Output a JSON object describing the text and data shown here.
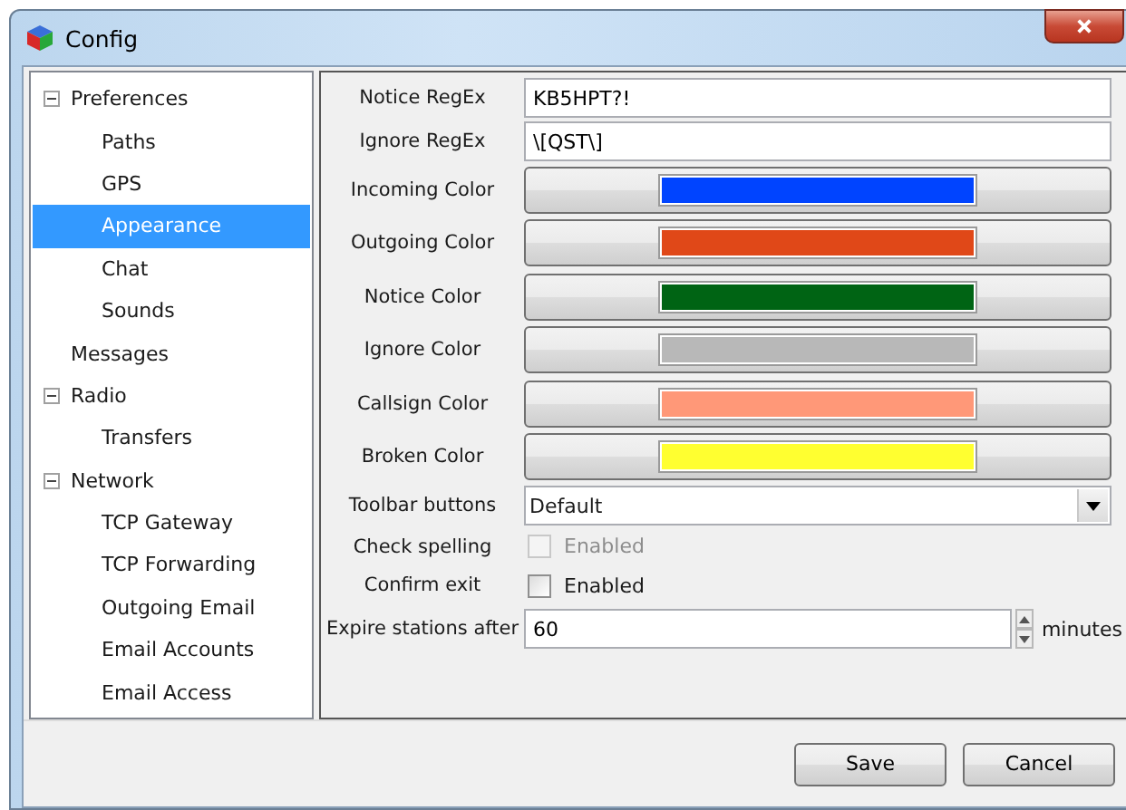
{
  "window": {
    "title": "Config"
  },
  "tree": [
    {
      "label": "Preferences",
      "expanded": true,
      "selected": false,
      "children": [
        {
          "label": "Paths",
          "selected": false
        },
        {
          "label": "GPS",
          "selected": false
        },
        {
          "label": "Appearance",
          "selected": true
        },
        {
          "label": "Chat",
          "selected": false
        },
        {
          "label": "Sounds",
          "selected": false
        }
      ]
    },
    {
      "label": "Messages",
      "selected": false
    },
    {
      "label": "Radio",
      "expanded": true,
      "selected": false,
      "children": [
        {
          "label": "Transfers",
          "selected": false
        }
      ]
    },
    {
      "label": "Network",
      "expanded": true,
      "selected": false,
      "children": [
        {
          "label": "TCP Gateway",
          "selected": false
        },
        {
          "label": "TCP Forwarding",
          "selected": false
        },
        {
          "label": "Outgoing Email",
          "selected": false
        },
        {
          "label": "Email Accounts",
          "selected": false
        },
        {
          "label": "Email Access",
          "selected": false
        }
      ]
    }
  ],
  "settings": [
    {
      "kind": "text",
      "label": "Notice RegEx",
      "value": "KB5HPT?!"
    },
    {
      "kind": "text",
      "label": "Ignore RegEx",
      "value": "\\[QST\\]"
    },
    {
      "kind": "color",
      "label": "Incoming Color",
      "color": "#0044ff"
    },
    {
      "kind": "color",
      "label": "Outgoing Color",
      "color": "#e04818"
    },
    {
      "kind": "color",
      "label": "Notice Color",
      "color": "#006414"
    },
    {
      "kind": "color",
      "label": "Ignore Color",
      "color": "#b8b8b8"
    },
    {
      "kind": "color",
      "label": "Callsign Color",
      "color": "#ff9878"
    },
    {
      "kind": "color",
      "label": "Broken Color",
      "color": "#ffff30"
    },
    {
      "kind": "dropdown",
      "label": "Toolbar buttons",
      "value": "Default"
    },
    {
      "kind": "checkbox",
      "label": "Check spelling",
      "text": "Enabled",
      "checked": false,
      "disabled": true
    },
    {
      "kind": "checkbox",
      "label": "Confirm exit",
      "text": "Enabled",
      "checked": false,
      "disabled": false
    },
    {
      "kind": "spin",
      "label": "Expire stations after",
      "value": "60",
      "unit": "minutes"
    }
  ],
  "buttons": [
    "Save",
    "Cancel"
  ]
}
